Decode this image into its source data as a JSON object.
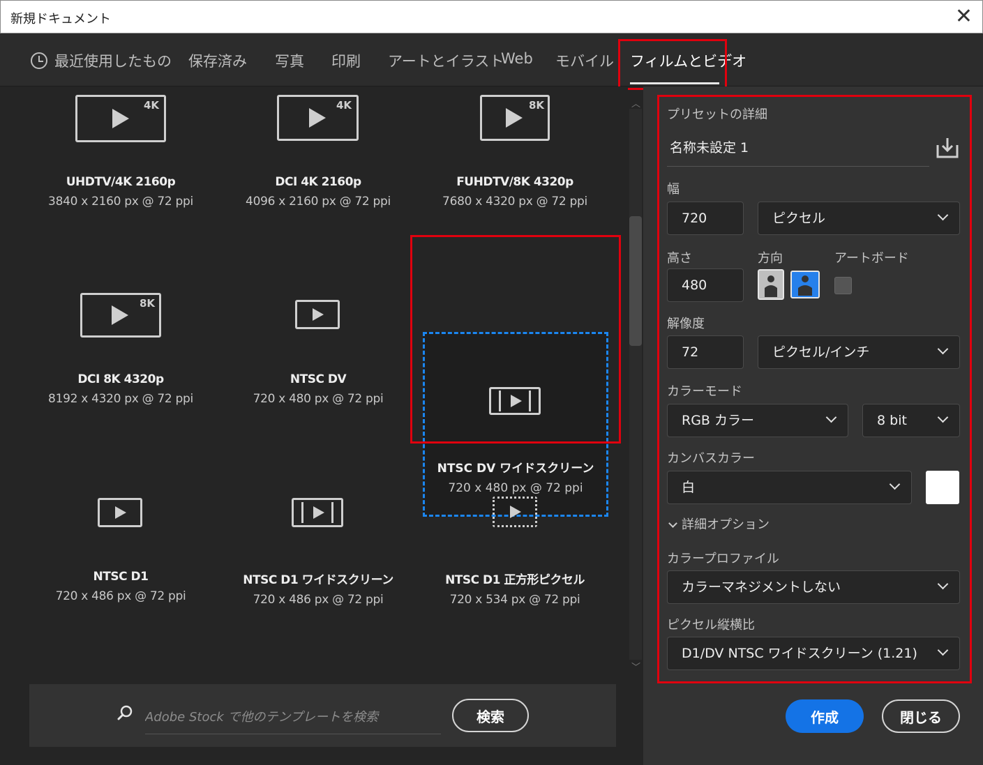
{
  "window": {
    "title": "新規ドキュメント",
    "close_symbol": "✕"
  },
  "tabs": [
    {
      "label": "最近使用したもの",
      "icon": "clock-icon"
    },
    {
      "label": "保存済み"
    },
    {
      "label": "写真"
    },
    {
      "label": "印刷"
    },
    {
      "label": "アートとイラスト"
    },
    {
      "label": "Web"
    },
    {
      "label": "モバイル"
    },
    {
      "label": "フィルムとビデオ",
      "active": true
    }
  ],
  "presets": [
    {
      "name": "UHDTV/4K 2160p",
      "size": "3840 x 2160 px @ 72 ppi",
      "badge": "4K"
    },
    {
      "name": "DCI 4K 2160p",
      "size": "4096 x 2160 px @ 72 ppi",
      "badge": "4K"
    },
    {
      "name": "FUHDTV/8K 4320p",
      "size": "7680 x 4320 px @ 72 ppi",
      "badge": "8K"
    },
    {
      "name": "DCI 8K 4320p",
      "size": "8192 x 4320 px @ 72 ppi",
      "badge": "8K"
    },
    {
      "name": "NTSC DV",
      "size": "720 x 480 px @ 72 ppi"
    },
    {
      "name": "NTSC DV ワイドスクリーン",
      "size": "720 x 480 px @ 72 ppi",
      "selected": true
    },
    {
      "name": "NTSC D1",
      "size": "720 x 486 px @ 72 ppi"
    },
    {
      "name": "NTSC D1 ワイドスクリーン",
      "size": "720 x 486 px @ 72 ppi"
    },
    {
      "name": "NTSC D1 正方形ピクセル",
      "size": "720 x 534 px @ 72 ppi"
    }
  ],
  "search": {
    "placeholder": "Adobe Stock で他のテンプレートを検索",
    "button": "検索"
  },
  "details": {
    "heading": "プリセットの詳細",
    "doc_name": "名称未設定 1",
    "width_label": "幅",
    "width_value": "720",
    "width_unit": "ピクセル",
    "height_label": "高さ",
    "height_value": "480",
    "orientation_label": "方向",
    "artboard_label": "アートボード",
    "resolution_label": "解像度",
    "resolution_value": "72",
    "resolution_unit": "ピクセル/インチ",
    "color_mode_label": "カラーモード",
    "color_mode": "RGB カラー",
    "bit_depth": "8 bit",
    "canvas_color_label": "カンバスカラー",
    "canvas_color": "白",
    "canvas_swatch": "#ffffff",
    "advanced_label": "詳細オプション",
    "color_profile_label": "カラープロファイル",
    "color_profile": "カラーマネジメントしない",
    "pixel_aspect_label": "ピクセル縦横比",
    "pixel_aspect": "D1/DV NTSC ワイドスクリーン (1.21)"
  },
  "actions": {
    "create": "作成",
    "close": "閉じる"
  },
  "colors": {
    "accent": "#1473e6",
    "highlight_box": "#e0000e",
    "selection": "#1b86f0"
  }
}
